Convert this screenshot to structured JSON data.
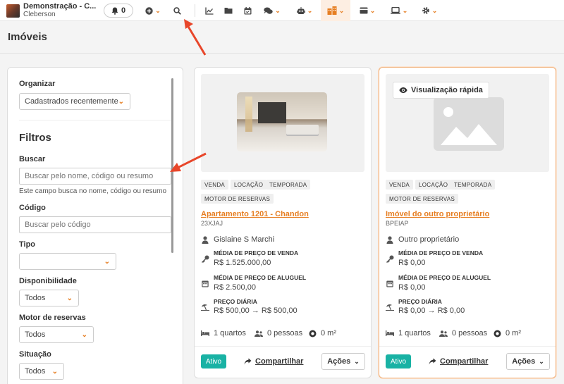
{
  "topbar": {
    "app_title": "Demonstração - C...",
    "user_name": "Cleberson",
    "notifications_count": "0",
    "icons": [
      "plus-circle-icon",
      "search-icon",
      "chart-icon",
      "folder-icon",
      "calendar-icon",
      "comments-icon",
      "robot-icon",
      "buildings-icon",
      "card-icon",
      "laptop-icon",
      "gear-icon"
    ],
    "accent": "#e67e22"
  },
  "page": {
    "title": "Imóveis"
  },
  "filters": {
    "organize_label": "Organizar",
    "organize_value": "Cadastrados recentemente",
    "heading": "Filtros",
    "search_label": "Buscar",
    "search_placeholder": "Buscar pelo nome, código ou resumo",
    "search_hint": "Este campo busca no nome, código ou resumo",
    "code_label": "Código",
    "code_placeholder": "Buscar pelo código",
    "type_label": "Tipo",
    "type_value": "",
    "availability_label": "Disponibilidade",
    "availability_value": "Todos",
    "booking_engine_label": "Motor de reservas",
    "booking_engine_value": "Todos",
    "situation_label": "Situação",
    "situation_value": "Todos"
  },
  "cards": [
    {
      "tags": [
        "VENDA",
        "LOCAÇÃO",
        "TEMPORADA",
        "MOTOR DE RESERVAS"
      ],
      "title": "Apartamento 1201 - Chandon",
      "code": "23XJAJ",
      "owner": "Gislaine S Marchi",
      "sale_label": "MÉDIA DE PREÇO DE VENDA",
      "sale_value": "R$ 1.525.000,00",
      "rent_label": "MÉDIA DE PREÇO DE ALUGUEL",
      "rent_value": "R$ 2.500,00",
      "daily_label": "PREÇO DIÁRIA",
      "daily_from": "R$ 500,00",
      "daily_to": "R$ 500,00",
      "rooms": "1 quartos",
      "people": "0 pessoas",
      "area": "0 m²",
      "status": "Ativo",
      "share_label": "Compartilhar",
      "actions_label": "Ações"
    },
    {
      "quick_view": "Visualização rápida",
      "tags": [
        "VENDA",
        "LOCAÇÃO",
        "TEMPORADA",
        "MOTOR DE RESERVAS"
      ],
      "title": "Imóvel do outro proprietário",
      "code": "BPEIAP",
      "owner": "Outro proprietário",
      "sale_label": "MÉDIA DE PREÇO DE VENDA",
      "sale_value": "R$ 0,00",
      "rent_label": "MÉDIA DE PREÇO DE ALUGUEL",
      "rent_value": "R$ 0,00",
      "daily_label": "PREÇO DIÁRIA",
      "daily_from": "R$ 0,00",
      "daily_to": "R$ 0,00",
      "rooms": "1 quartos",
      "people": "0 pessoas",
      "area": "0 m²",
      "status": "Ativo",
      "share_label": "Compartilhar",
      "actions_label": "Ações"
    }
  ],
  "colors": {
    "accent": "#e67e22",
    "status_active": "#19b2a4",
    "annotation_arrow": "#e8462a"
  }
}
